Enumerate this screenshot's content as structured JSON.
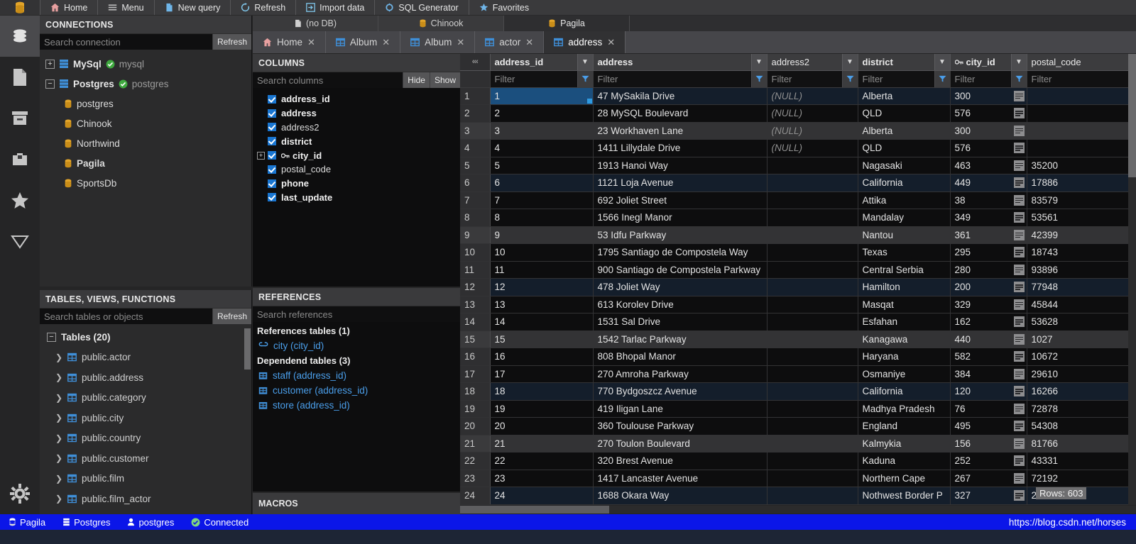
{
  "toolbar": {
    "logo_icon": "database-icon",
    "items": [
      {
        "label": "Home",
        "icon": "home-icon"
      },
      {
        "label": "Menu",
        "icon": "hamburger-icon"
      },
      {
        "label": "New query",
        "icon": "file-icon"
      },
      {
        "label": "Refresh",
        "icon": "refresh-icon"
      },
      {
        "label": "Import data",
        "icon": "import-icon"
      },
      {
        "label": "SQL Generator",
        "icon": "sql-gear-icon"
      },
      {
        "label": "Favorites",
        "icon": "star-icon"
      }
    ]
  },
  "rail": {
    "items": [
      {
        "name": "database-icon",
        "active": true
      },
      {
        "name": "file-icon",
        "active": false
      },
      {
        "name": "archive-icon",
        "active": false
      },
      {
        "name": "puzzle-icon",
        "active": false
      },
      {
        "name": "star-icon",
        "active": false
      },
      {
        "name": "funnel-icon",
        "active": false
      }
    ],
    "settings_icon": "gear-icon"
  },
  "connections": {
    "title": "CONNECTIONS",
    "search_placeholder": "Search connection",
    "search_value": "",
    "refresh_label": "Refresh",
    "tree": [
      {
        "type": "server",
        "expander": "+",
        "label": "MySql",
        "sub": "mysql",
        "status": "connected",
        "icon": "server-icon"
      },
      {
        "type": "server",
        "expander": "−",
        "label": "Postgres",
        "sub": "postgres",
        "status": "connected",
        "icon": "server-icon"
      },
      {
        "type": "db",
        "label": "postgres",
        "bold": false,
        "icon": "database-icon"
      },
      {
        "type": "db",
        "label": "Chinook",
        "bold": false,
        "icon": "database-icon"
      },
      {
        "type": "db",
        "label": "Northwind",
        "bold": false,
        "icon": "database-icon"
      },
      {
        "type": "db",
        "label": "Pagila",
        "bold": true,
        "icon": "database-icon"
      },
      {
        "type": "db",
        "label": "SportsDb",
        "bold": false,
        "icon": "database-icon"
      }
    ]
  },
  "tables_panel": {
    "title": "TABLES, VIEWS, FUNCTIONS",
    "search_placeholder": "Search tables or objects",
    "search_value": "",
    "refresh_label": "Refresh",
    "group_label": "Tables (20)",
    "group_expander": "−",
    "items": [
      {
        "label": "public.actor"
      },
      {
        "label": "public.address"
      },
      {
        "label": "public.category"
      },
      {
        "label": "public.city"
      },
      {
        "label": "public.country"
      },
      {
        "label": "public.customer"
      },
      {
        "label": "public.film"
      },
      {
        "label": "public.film_actor"
      }
    ]
  },
  "columns_panel": {
    "title": "COLUMNS",
    "search_placeholder": "Search columns",
    "search_value": "",
    "hide_label": "Hide",
    "show_label": "Show",
    "items": [
      {
        "label": "address_id",
        "checked": true,
        "bold": true,
        "expander": false,
        "key": false
      },
      {
        "label": "address",
        "checked": true,
        "bold": true,
        "expander": false,
        "key": false
      },
      {
        "label": "address2",
        "checked": true,
        "bold": false,
        "expander": false,
        "key": false
      },
      {
        "label": "district",
        "checked": true,
        "bold": true,
        "expander": false,
        "key": false
      },
      {
        "label": "city_id",
        "checked": true,
        "bold": true,
        "expander": true,
        "key": true
      },
      {
        "label": "postal_code",
        "checked": true,
        "bold": false,
        "expander": false,
        "key": false
      },
      {
        "label": "phone",
        "checked": true,
        "bold": true,
        "expander": false,
        "key": false
      },
      {
        "label": "last_update",
        "checked": true,
        "bold": true,
        "expander": false,
        "key": false
      }
    ]
  },
  "references_panel": {
    "title": "REFERENCES",
    "search_placeholder": "Search references",
    "search_value": "",
    "references_header": "References tables (1)",
    "references": [
      {
        "label": "city (city_id)",
        "icon": "link-icon"
      }
    ],
    "dependent_header": "Dependend tables (3)",
    "dependents": [
      {
        "label": "staff (address_id)",
        "icon": "table-icon"
      },
      {
        "label": "customer (address_id)",
        "icon": "table-icon"
      },
      {
        "label": "store (address_id)",
        "icon": "table-icon"
      }
    ]
  },
  "macros_panel": {
    "title": "MACROS"
  },
  "db_tabs": [
    {
      "label": "(no DB)",
      "icon": "file-icon",
      "active": false
    },
    {
      "label": "Chinook",
      "icon": "database-icon",
      "active": false
    },
    {
      "label": "Pagila",
      "icon": "database-icon",
      "active": true
    }
  ],
  "query_tabs": [
    {
      "label": "Home",
      "icon": "home-icon",
      "active": false,
      "closable": true
    },
    {
      "label": "Album",
      "icon": "table-icon",
      "active": false,
      "closable": true
    },
    {
      "label": "Album",
      "icon": "table-icon",
      "active": false,
      "closable": true
    },
    {
      "label": "actor",
      "icon": "table-icon",
      "active": false,
      "closable": true
    },
    {
      "label": "address",
      "icon": "table-icon",
      "active": true,
      "closable": true
    }
  ],
  "grid": {
    "collapse_icon": "collapse-left-icon",
    "filter_placeholder": "Filter",
    "null_text": "(NULL)",
    "row_count_tooltip": "Rows: 603",
    "columns": [
      {
        "key": "address_id",
        "label": "address_id",
        "bold": true,
        "pk": false,
        "filter": ""
      },
      {
        "key": "address",
        "label": "address",
        "bold": true,
        "pk": false,
        "filter": ""
      },
      {
        "key": "address2",
        "label": "address2",
        "bold": false,
        "pk": false,
        "filter": ""
      },
      {
        "key": "district",
        "label": "district",
        "bold": true,
        "pk": false,
        "filter": ""
      },
      {
        "key": "city_id",
        "label": "city_id",
        "bold": true,
        "pk": true,
        "filter": ""
      },
      {
        "key": "postal_code",
        "label": "postal_code",
        "bold": false,
        "pk": false,
        "filter": ""
      }
    ],
    "rows": [
      {
        "n": "1",
        "address_id": "1",
        "address": "47 MySakila Drive",
        "address2": "(NULL)",
        "district": "Alberta",
        "city_id": "300",
        "postal_code": "",
        "style": "sel",
        "cursor": true
      },
      {
        "n": "2",
        "address_id": "2",
        "address": "28 MySQL Boulevard",
        "address2": "(NULL)",
        "district": "QLD",
        "city_id": "576",
        "postal_code": "",
        "style": "odd",
        "cursor": false
      },
      {
        "n": "3",
        "address_id": "3",
        "address": "23 Workhaven Lane",
        "address2": "(NULL)",
        "district": "Alberta",
        "city_id": "300",
        "postal_code": "",
        "style": "alt",
        "cursor": false
      },
      {
        "n": "4",
        "address_id": "4",
        "address": "1411 Lillydale Drive",
        "address2": "(NULL)",
        "district": "QLD",
        "city_id": "576",
        "postal_code": "",
        "style": "odd",
        "cursor": false
      },
      {
        "n": "5",
        "address_id": "5",
        "address": "1913 Hanoi Way",
        "address2": "",
        "district": "Nagasaki",
        "city_id": "463",
        "postal_code": "35200",
        "style": "odd",
        "cursor": false
      },
      {
        "n": "6",
        "address_id": "6",
        "address": "1121 Loja Avenue",
        "address2": "",
        "district": "California",
        "city_id": "449",
        "postal_code": "17886",
        "style": "sel",
        "cursor": false
      },
      {
        "n": "7",
        "address_id": "7",
        "address": "692 Joliet Street",
        "address2": "",
        "district": "Attika",
        "city_id": "38",
        "postal_code": "83579",
        "style": "odd",
        "cursor": false
      },
      {
        "n": "8",
        "address_id": "8",
        "address": "1566 Inegl Manor",
        "address2": "",
        "district": "Mandalay",
        "city_id": "349",
        "postal_code": "53561",
        "style": "odd",
        "cursor": false
      },
      {
        "n": "9",
        "address_id": "9",
        "address": "53 Idfu Parkway",
        "address2": "",
        "district": "Nantou",
        "city_id": "361",
        "postal_code": "42399",
        "style": "alt",
        "cursor": false
      },
      {
        "n": "10",
        "address_id": "10",
        "address": "1795 Santiago de Compostela Way",
        "address2": "",
        "district": "Texas",
        "city_id": "295",
        "postal_code": "18743",
        "style": "odd",
        "cursor": false
      },
      {
        "n": "11",
        "address_id": "11",
        "address": "900 Santiago de Compostela Parkway",
        "address2": "",
        "district": "Central Serbia",
        "city_id": "280",
        "postal_code": "93896",
        "style": "odd",
        "cursor": false
      },
      {
        "n": "12",
        "address_id": "12",
        "address": "478 Joliet Way",
        "address2": "",
        "district": "Hamilton",
        "city_id": "200",
        "postal_code": "77948",
        "style": "sel",
        "cursor": false
      },
      {
        "n": "13",
        "address_id": "13",
        "address": "613 Korolev Drive",
        "address2": "",
        "district": "Masqat",
        "city_id": "329",
        "postal_code": "45844",
        "style": "odd",
        "cursor": false
      },
      {
        "n": "14",
        "address_id": "14",
        "address": "1531 Sal Drive",
        "address2": "",
        "district": "Esfahan",
        "city_id": "162",
        "postal_code": "53628",
        "style": "odd",
        "cursor": false
      },
      {
        "n": "15",
        "address_id": "15",
        "address": "1542 Tarlac Parkway",
        "address2": "",
        "district": "Kanagawa",
        "city_id": "440",
        "postal_code": "1027",
        "style": "alt",
        "cursor": false
      },
      {
        "n": "16",
        "address_id": "16",
        "address": "808 Bhopal Manor",
        "address2": "",
        "district": "Haryana",
        "city_id": "582",
        "postal_code": "10672",
        "style": "odd",
        "cursor": false
      },
      {
        "n": "17",
        "address_id": "17",
        "address": "270 Amroha Parkway",
        "address2": "",
        "district": "Osmaniye",
        "city_id": "384",
        "postal_code": "29610",
        "style": "odd",
        "cursor": false
      },
      {
        "n": "18",
        "address_id": "18",
        "address": "770 Bydgoszcz Avenue",
        "address2": "",
        "district": "California",
        "city_id": "120",
        "postal_code": "16266",
        "style": "sel",
        "cursor": false
      },
      {
        "n": "19",
        "address_id": "19",
        "address": "419 Iligan Lane",
        "address2": "",
        "district": "Madhya Pradesh",
        "city_id": "76",
        "postal_code": "72878",
        "style": "odd",
        "cursor": false
      },
      {
        "n": "20",
        "address_id": "20",
        "address": "360 Toulouse Parkway",
        "address2": "",
        "district": "England",
        "city_id": "495",
        "postal_code": "54308",
        "style": "odd",
        "cursor": false
      },
      {
        "n": "21",
        "address_id": "21",
        "address": "270 Toulon Boulevard",
        "address2": "",
        "district": "Kalmykia",
        "city_id": "156",
        "postal_code": "81766",
        "style": "alt",
        "cursor": false
      },
      {
        "n": "22",
        "address_id": "22",
        "address": "320 Brest Avenue",
        "address2": "",
        "district": "Kaduna",
        "city_id": "252",
        "postal_code": "43331",
        "style": "odd",
        "cursor": false
      },
      {
        "n": "23",
        "address_id": "23",
        "address": "1417 Lancaster Avenue",
        "address2": "",
        "district": "Northern Cape",
        "city_id": "267",
        "postal_code": "72192",
        "style": "odd",
        "cursor": false
      },
      {
        "n": "24",
        "address_id": "24",
        "address": "1688 Okara Way",
        "address2": "",
        "district": "Nothwest Border P",
        "city_id": "327",
        "postal_code": "2195",
        "style": "sel",
        "cursor": false
      }
    ]
  },
  "status_bar": {
    "database": "Pagila",
    "server": "Postgres",
    "user": "postgres",
    "connection_state": "Connected",
    "url": "https://blog.csdn.net/horses"
  },
  "colors": {
    "accent_blue": "#1976d2",
    "link_blue": "#4a9eea",
    "status_bar_blue": "#0b16e8",
    "connected_green": "#3fa93f",
    "db_icon_orange": "#e3a52a",
    "selection_blue": "#1b4f7e"
  }
}
